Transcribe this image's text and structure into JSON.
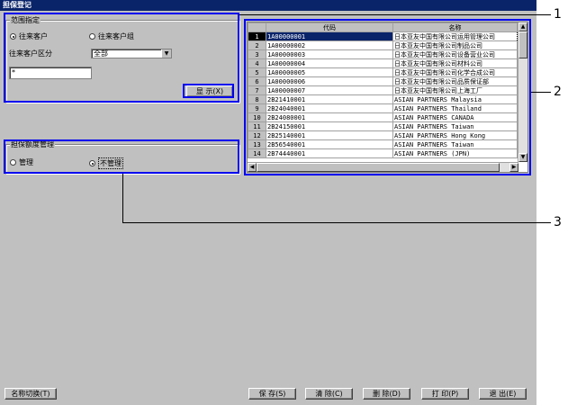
{
  "window": {
    "title": "担保登记"
  },
  "range_group": {
    "title": "范围指定",
    "radio_customer": "往来客户",
    "radio_customer_group": "往来客户组",
    "category_label": "往来客户区分",
    "category_value": "全部",
    "code_input_value": "*",
    "show_button": "显  示(X)"
  },
  "guarantee_group": {
    "title": "担保额度管理",
    "radio_manage": "管理",
    "radio_no_manage": "不管理"
  },
  "grid": {
    "headers": [
      "",
      "代码",
      "名称"
    ],
    "rows": [
      {
        "num": "1",
        "code": "1A00000001",
        "name": "日本亚友中国有限公司运用管理公司"
      },
      {
        "num": "2",
        "code": "1A00000002",
        "name": "日本亚友中国有限公司制品公司"
      },
      {
        "num": "3",
        "code": "1A00000003",
        "name": "日本亚友中国有限公司设备营业公司"
      },
      {
        "num": "4",
        "code": "1A00000004",
        "name": "日本亚友中国有限公司材料公司"
      },
      {
        "num": "5",
        "code": "1A00000005",
        "name": "日本亚友中国有限公司化学合成公司"
      },
      {
        "num": "6",
        "code": "1A00000006",
        "name": "日本亚友中国有限公司品质保证部"
      },
      {
        "num": "7",
        "code": "1A00000007",
        "name": "日本亚友中国有限公司上海工厂"
      },
      {
        "num": "8",
        "code": "2B21410001",
        "name": "ASIAN PARTNERS Malaysia"
      },
      {
        "num": "9",
        "code": "2B24040001",
        "name": "ASIAN PARTNERS Thailand"
      },
      {
        "num": "10",
        "code": "2B24080001",
        "name": "ASIAN PARTNERS CANADA"
      },
      {
        "num": "11",
        "code": "2B24150001",
        "name": "ASIAN PARTNERS Taiwan"
      },
      {
        "num": "12",
        "code": "2B25140001",
        "name": "ASIAN PARTNERS Hong Kong"
      },
      {
        "num": "13",
        "code": "2B56540001",
        "name": "ASIAN PARTNERS Taiwan"
      },
      {
        "num": "14",
        "code": "2B74440001",
        "name": "ASIAN PARTNERS (JPN)"
      }
    ]
  },
  "footer": {
    "switch_name": "名称切换(T)",
    "save": "保 存(S)",
    "clear": "清 除(C)",
    "delete": "删 除(D)",
    "print": "打 印(P)",
    "exit": "退 出(E)"
  },
  "callouts": [
    "1",
    "2",
    "3"
  ]
}
